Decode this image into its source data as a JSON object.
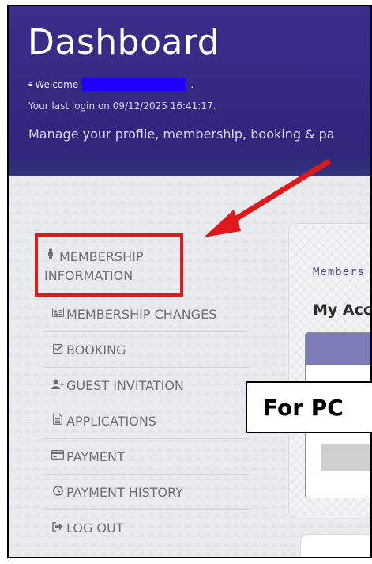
{
  "header": {
    "title": "Dashboard",
    "welcome_label": "Welcome",
    "welcome_suffix": ".",
    "last_login": "Your last login on 09/12/2025 16:41:17.",
    "subtitle": "Manage your profile, membership, booking & pa"
  },
  "sidebar": {
    "items": [
      {
        "label_line1": "MEMBERSHIP",
        "label_line2": "INFORMATION",
        "icon": "person-icon"
      },
      {
        "label": "MEMBERSHIP CHANGES",
        "icon": "id-card-icon"
      },
      {
        "label": "BOOKING",
        "icon": "checkbox-icon"
      },
      {
        "label": "GUEST INVITATION",
        "icon": "add-user-icon"
      },
      {
        "label": "APPLICATIONS",
        "icon": "document-icon"
      },
      {
        "label": "PAYMENT",
        "icon": "credit-card-icon"
      },
      {
        "label": "PAYMENT HISTORY",
        "icon": "clock-icon"
      },
      {
        "label": "LOG OUT",
        "icon": "sign-out-icon"
      }
    ]
  },
  "card": {
    "breadcrumb": "Members",
    "title": "My Acco"
  },
  "annotation": {
    "pc_label": "For PC",
    "highlight_color": "#e0181c"
  },
  "colors": {
    "header_bg": "#2e2479",
    "redaction": "#1f00ff",
    "accent": "#7b7cb8"
  }
}
